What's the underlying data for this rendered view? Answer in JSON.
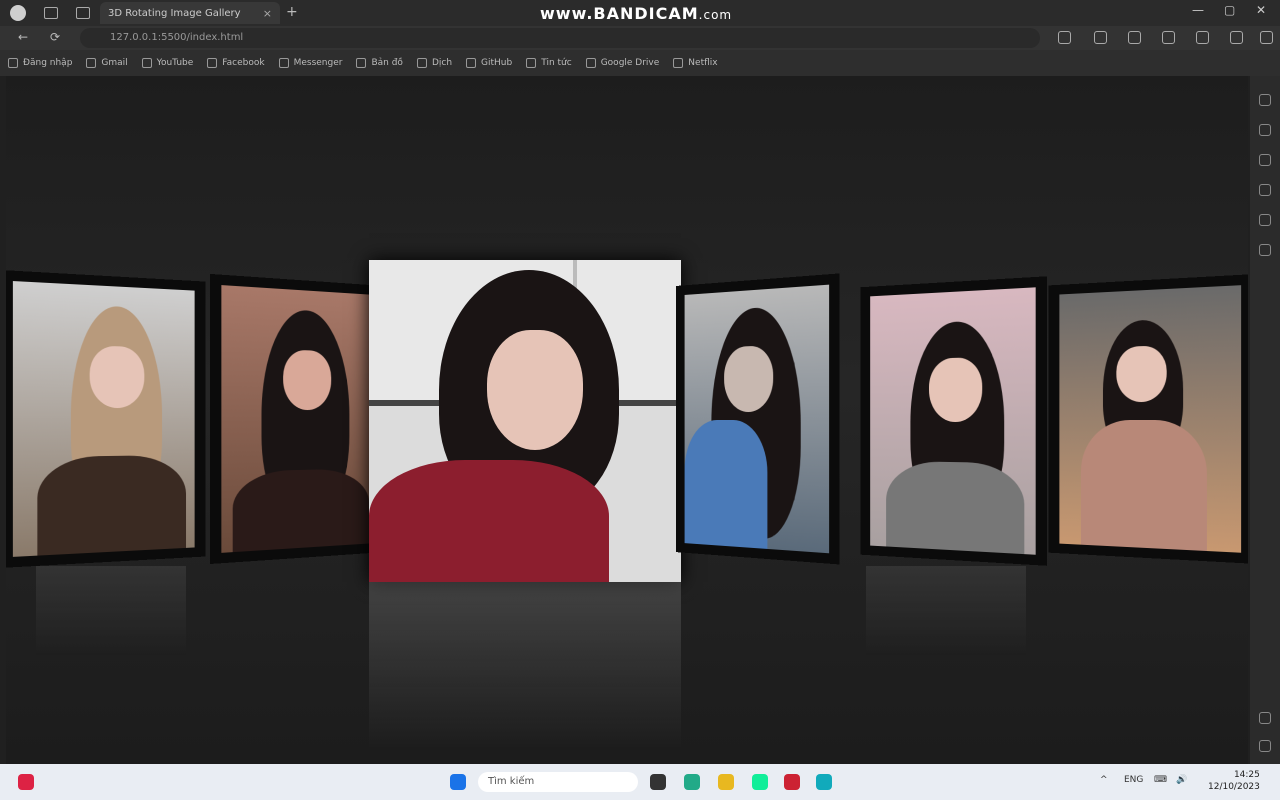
{
  "watermark": {
    "main": "www.BANDICAM",
    "suffix": ".com"
  },
  "browser": {
    "tab_title": "3D Rotating Image Gallery",
    "tab_close": "×",
    "new_tab": "+",
    "window_controls": [
      "—",
      "▢",
      "✕"
    ],
    "url": "127.0.0.1:5500/index.html",
    "back": "←",
    "forward": "→",
    "reload": "⟳",
    "bookmarks": [
      "Đăng nhập",
      "Gmail",
      "YouTube",
      "Facebook",
      "Messenger",
      "Bản đồ",
      "Dịch",
      "GitHub",
      "Tin tức",
      "Google Drive",
      "Netflix"
    ]
  },
  "taskbar": {
    "search_placeholder": "Tìm kiếm",
    "tray": [
      "^",
      "ENG",
      "⌨",
      "🔊"
    ],
    "time": "14:25",
    "date": "12/10/2023"
  }
}
